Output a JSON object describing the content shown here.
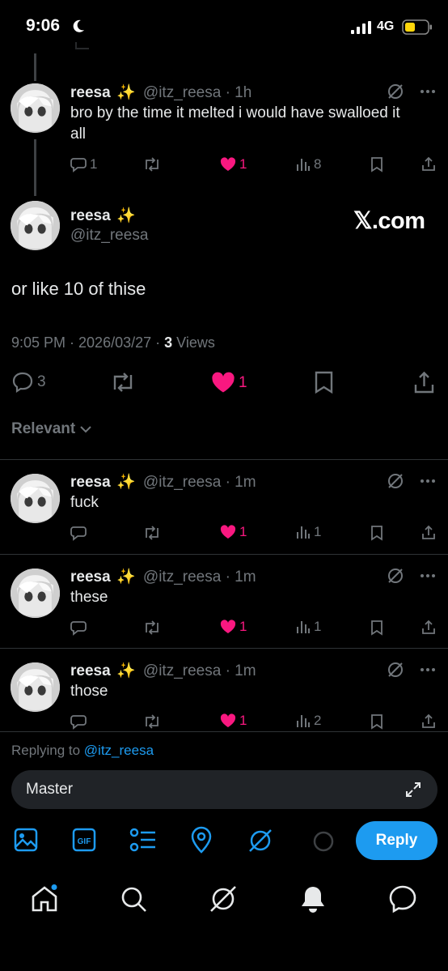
{
  "status_bar": {
    "time": "9:06",
    "network": "4G"
  },
  "tweets": [
    {
      "name": "reesa",
      "emoji": "✨",
      "handle": "@itz_reesa",
      "time": "· 1h",
      "text": "bro by the time it melted i would have swalloed it all",
      "replies": "1",
      "reposts": "",
      "likes": "1",
      "views": "8"
    }
  ],
  "main_tweet": {
    "name": "reesa",
    "emoji": "✨",
    "handle": "@itz_reesa",
    "watermark": "𝕏.com",
    "text": "or like 10 of thise",
    "meta_time": "9:05 PM · 2026/03/27 · ",
    "views_count": "3",
    "views_label": " Views",
    "replies": "3",
    "likes": "1"
  },
  "sort_label": "Relevant",
  "replies": [
    {
      "name": "reesa",
      "emoji": "✨",
      "handle": "@itz_reesa",
      "time": "· 1m",
      "text": "fuck",
      "likes": "1",
      "views": "1"
    },
    {
      "name": "reesa",
      "emoji": "✨",
      "handle": "@itz_reesa",
      "time": "· 1m",
      "text": "these",
      "likes": "1",
      "views": "1"
    },
    {
      "name": "reesa",
      "emoji": "✨",
      "handle": "@itz_reesa",
      "time": "· 1m",
      "text": "those",
      "likes": "1",
      "views": "2"
    }
  ],
  "composer": {
    "replying_prefix": "Replying to ",
    "replying_to": "@itz_reesa",
    "input_value": "Master",
    "reply_label": "Reply"
  },
  "colors": {
    "accent": "#1d9bf0",
    "like": "#f91880",
    "muted": "#71767b"
  }
}
